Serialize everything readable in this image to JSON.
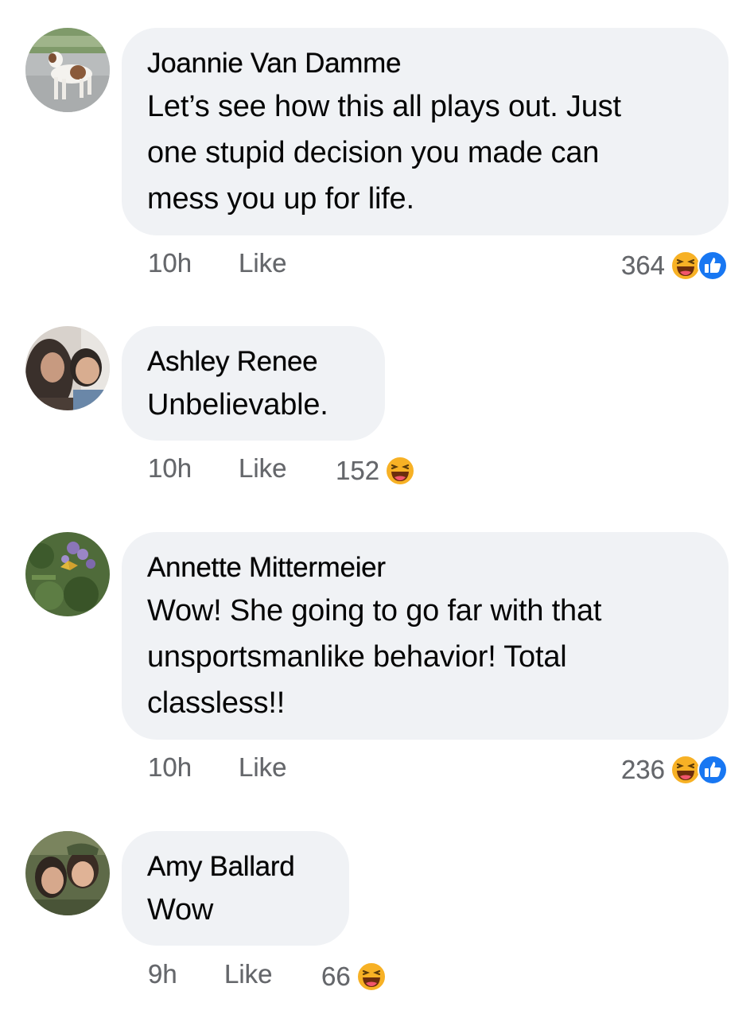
{
  "comments": [
    {
      "author": "Joannie Van Damme",
      "lines": [
        "Let’s see how this all plays out. Just",
        "one stupid decision you made can",
        "mess you up for life."
      ],
      "time": "10h",
      "like_label": "Like",
      "reaction_count": "364",
      "reactions": [
        "haha-icon",
        "like-icon"
      ]
    },
    {
      "author": "Ashley Renee",
      "lines": [
        "Unbelievable."
      ],
      "time": "10h",
      "like_label": "Like",
      "reaction_count": "152",
      "reactions": [
        "haha-icon"
      ]
    },
    {
      "author": "Annette Mittermeier",
      "lines": [
        "Wow! She going to go far with that",
        "unsportsmanlike behavior! Total",
        "classless!!"
      ],
      "time": "10h",
      "like_label": "Like",
      "reaction_count": "236",
      "reactions": [
        "haha-icon",
        "like-icon"
      ]
    },
    {
      "author": "Amy Ballard",
      "lines": [
        "Wow"
      ],
      "time": "9h",
      "like_label": "Like",
      "reaction_count": "66",
      "reactions": [
        "haha-icon"
      ]
    }
  ],
  "colors": {
    "bubble": "#f0f2f5",
    "meta_text": "#65676b",
    "haha_yellow": "#f7b125",
    "like_blue": "#1877f2"
  }
}
